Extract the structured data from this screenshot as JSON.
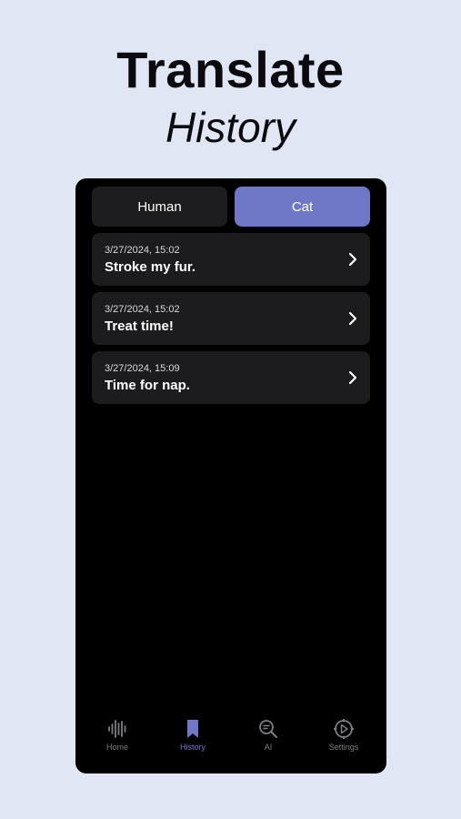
{
  "headline": {
    "line1": "Translate",
    "line2": "History"
  },
  "segments": {
    "human": "Human",
    "cat": "Cat",
    "selected": "Cat"
  },
  "history": [
    {
      "timestamp": "3/27/2024, 15:02",
      "text": "Stroke my fur."
    },
    {
      "timestamp": "3/27/2024, 15:02",
      "text": "Treat time!"
    },
    {
      "timestamp": "3/27/2024, 15:09",
      "text": "Time for nap."
    }
  ],
  "tabs": [
    {
      "label": "Home",
      "icon": "waveform-icon"
    },
    {
      "label": "History",
      "icon": "bookmark-icon",
      "active": true
    },
    {
      "label": "AI",
      "icon": "magnifier-icon"
    },
    {
      "label": "Settings",
      "icon": "gear-play-icon"
    }
  ],
  "colors": {
    "accent": "#6f78c6",
    "background": "#e0e6f3",
    "card": "#1c1c1f"
  }
}
